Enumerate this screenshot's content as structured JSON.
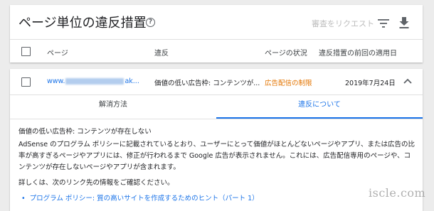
{
  "header": {
    "title": "ページ単位の違反措置",
    "help_icon": "help-circle-icon",
    "review_request_label": "審査をリクエスト",
    "filter_icon": "filter-icon",
    "download_icon": "download-icon"
  },
  "table": {
    "columns": [
      "ページ",
      "違反",
      "ページの状況",
      "違反措置の前回の適用日"
    ],
    "rows": [
      {
        "page_prefix": "www.",
        "page_suffix": "ak...",
        "violation": "価値の低い広告枠: コンテンツが...",
        "status": "広告配信の制限",
        "date": "2019年7月24日"
      }
    ]
  },
  "tabs": [
    {
      "label": "解消方法",
      "active": false
    },
    {
      "label": "違反について",
      "active": true
    }
  ],
  "detail": {
    "heading": "価値の低い広告枠: コンテンツが存在しない",
    "paragraph": "AdSense のプログラム ポリシーに記載されているとおり、ユーザーにとって価値がほとんどないページやアプリ、または広告の比率が高すぎるページやアプリには、修正が行われるまで Google 広告が表示されません。これには、広告配信専用のページや、コンテンツが存在しないページやアプリが含まれます。",
    "details_intro": "詳しくは、次のリンク先の情報をご確認ください。",
    "link": "プログラム ポリシー: 質の高いサイトを作成するためのヒント（パート 1）"
  },
  "watermark": "iscle.com",
  "colors": {
    "accent": "#1a73e8",
    "status_warning": "#e37400",
    "disabled_text": "#bdbdbd"
  }
}
